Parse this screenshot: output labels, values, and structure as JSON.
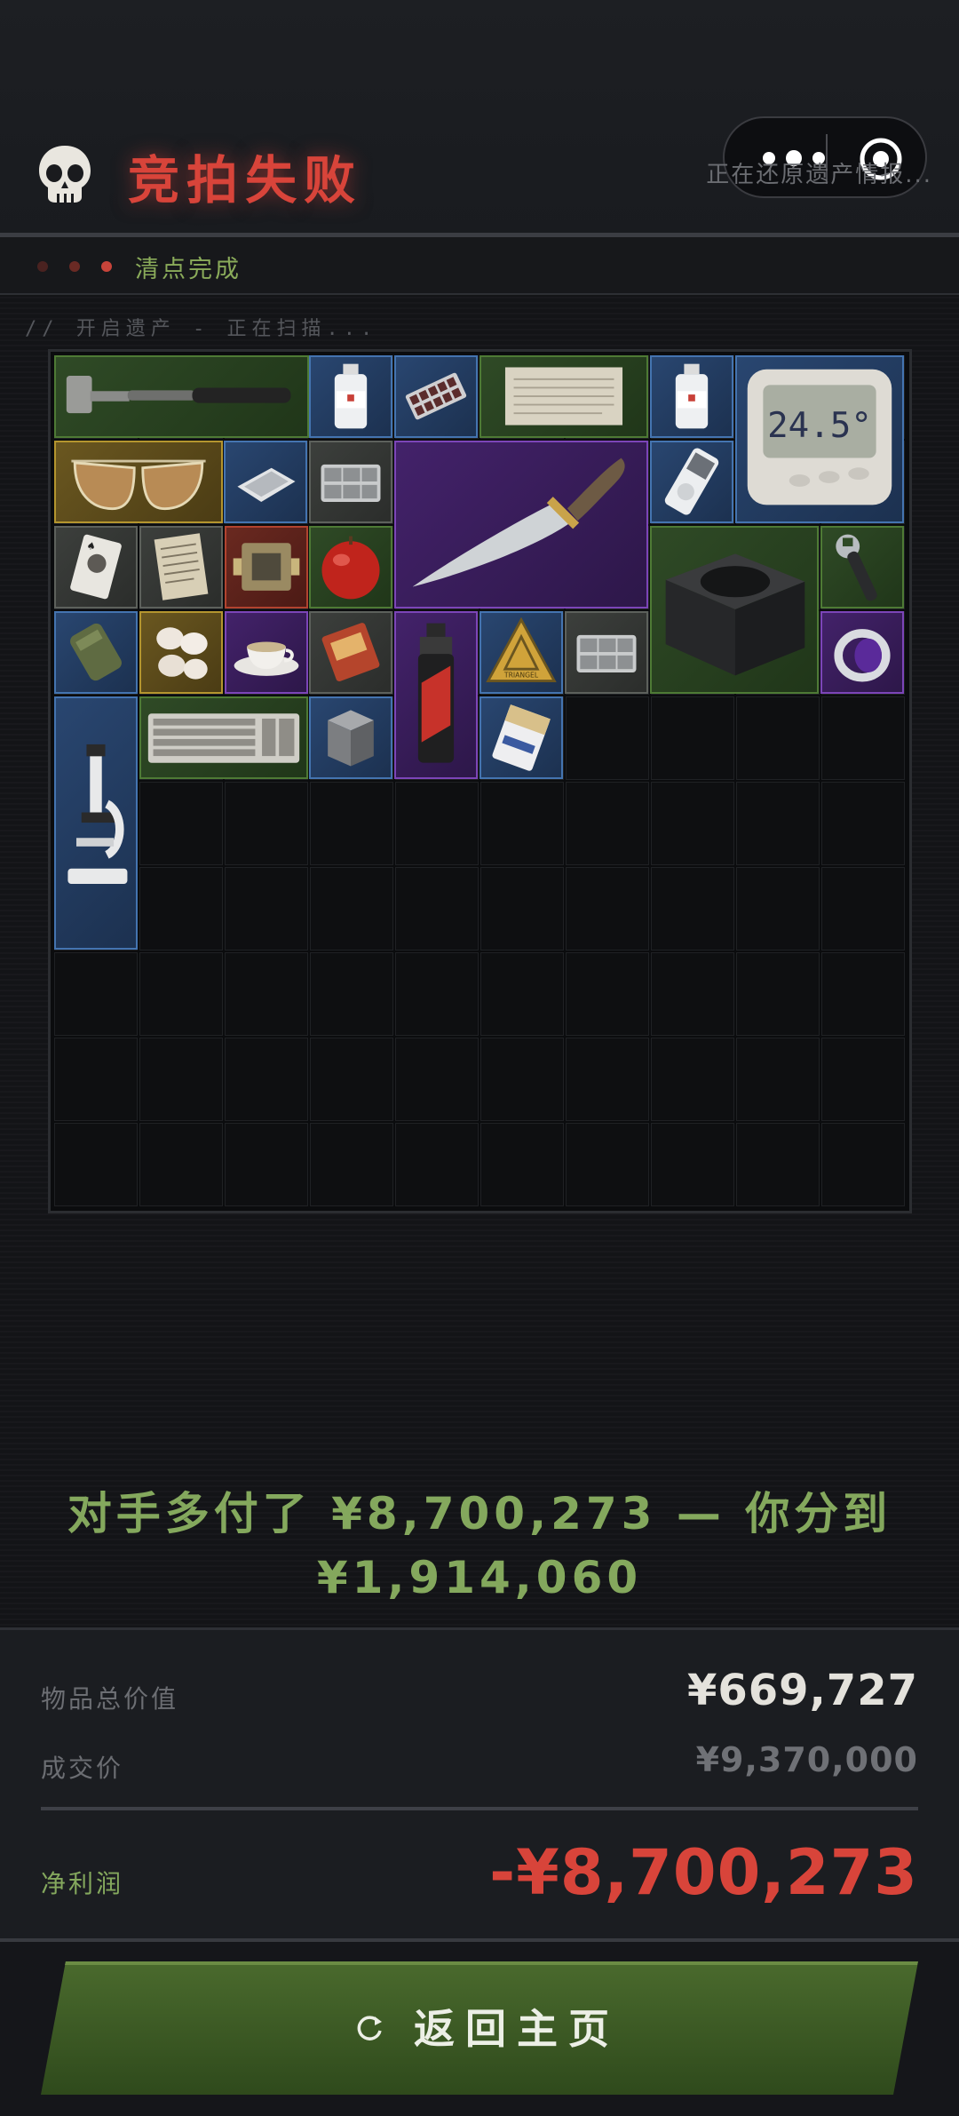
{
  "header": {
    "title": "竞拍失败",
    "restoring_text": "正在还原遗产情报...",
    "skull_icon": "skull-icon"
  },
  "capsule": {
    "more_icon": "more-dots-icon",
    "close_icon": "target-icon"
  },
  "status": {
    "text": "清点完成"
  },
  "scan_text": "// 开启遗产 - 正在扫描...",
  "inventory": {
    "columns": 10,
    "rows": 10,
    "items": [
      {
        "name": "sledgehammer",
        "rarity": "green",
        "icon": "hammer-icon"
      },
      {
        "name": "saline-bottle",
        "rarity": "blue",
        "icon": "bottle-icon"
      },
      {
        "name": "pill-strip",
        "rarity": "blue",
        "icon": "pills-icon"
      },
      {
        "name": "paper-scroll",
        "rarity": "green",
        "icon": "paper-icon"
      },
      {
        "name": "saline-bottle-2",
        "rarity": "blue",
        "icon": "bottle-icon"
      },
      {
        "name": "thermometer-device",
        "rarity": "blue",
        "icon": "thermometer-icon",
        "reading": "24.5°"
      },
      {
        "name": "aviator-sunglasses",
        "rarity": "gold",
        "icon": "sunglasses-icon"
      },
      {
        "name": "silver-plate",
        "rarity": "blue",
        "icon": "plate-icon"
      },
      {
        "name": "organizer-tray",
        "rarity": "gray",
        "icon": "tray-icon"
      },
      {
        "name": "combat-knife",
        "rarity": "purple",
        "icon": "knife-icon"
      },
      {
        "name": "mp3-player",
        "rarity": "blue",
        "icon": "mp3-icon"
      },
      {
        "name": "playing-card",
        "rarity": "gray",
        "icon": "card-icon"
      },
      {
        "name": "old-document",
        "rarity": "gray",
        "icon": "document-icon"
      },
      {
        "name": "circuit-module",
        "rarity": "red",
        "icon": "circuit-icon"
      },
      {
        "name": "red-apple",
        "rarity": "green",
        "icon": "apple-icon"
      },
      {
        "name": "power-supply",
        "rarity": "green",
        "icon": "psu-icon"
      },
      {
        "name": "wrench",
        "rarity": "green",
        "icon": "wrench-icon"
      },
      {
        "name": "ration-pack",
        "rarity": "blue",
        "icon": "ration-icon"
      },
      {
        "name": "pearls",
        "rarity": "gold",
        "icon": "pearls-icon"
      },
      {
        "name": "teacup",
        "rarity": "purple",
        "icon": "teacup-icon"
      },
      {
        "name": "snack-bag",
        "rarity": "gray",
        "icon": "snack-icon"
      },
      {
        "name": "spray-can",
        "rarity": "purple",
        "icon": "spray-icon"
      },
      {
        "name": "warning-sign",
        "rarity": "blue",
        "icon": "triangle-sign-icon",
        "label": "TRIANGEL"
      },
      {
        "name": "organizer-tray-2",
        "rarity": "gray",
        "icon": "tray-icon"
      },
      {
        "name": "purple-ring",
        "rarity": "purple",
        "icon": "ring-icon"
      },
      {
        "name": "microscope",
        "rarity": "blue",
        "icon": "microscope-icon"
      },
      {
        "name": "keyboard",
        "rarity": "green",
        "icon": "keyboard-icon"
      },
      {
        "name": "metal-canister",
        "rarity": "blue",
        "icon": "canister-icon"
      },
      {
        "name": "cigarette-pack",
        "rarity": "blue",
        "icon": "cigarettes-icon"
      }
    ]
  },
  "message": {
    "line1": "对手多付了 ¥8,700,273 — 你分到",
    "line2": "¥1,914,060"
  },
  "summary": {
    "total_label": "物品总价值",
    "total_value": "¥669,727",
    "deal_label": "成交价",
    "deal_value": "¥9,370,000",
    "profit_label": "净利润",
    "profit_value": "-¥8,700,273"
  },
  "colors": {
    "loss_red": "#d8443a",
    "profit_green": "#84a85d",
    "rarity": {
      "green": "#4e7a35",
      "blue": "#4474b0",
      "purple": "#7c45b8",
      "gold": "#b4952e",
      "gray": "#5d615c",
      "red": "#b2432f"
    }
  },
  "button": {
    "label": "返回主页",
    "icon": "refresh-icon"
  }
}
